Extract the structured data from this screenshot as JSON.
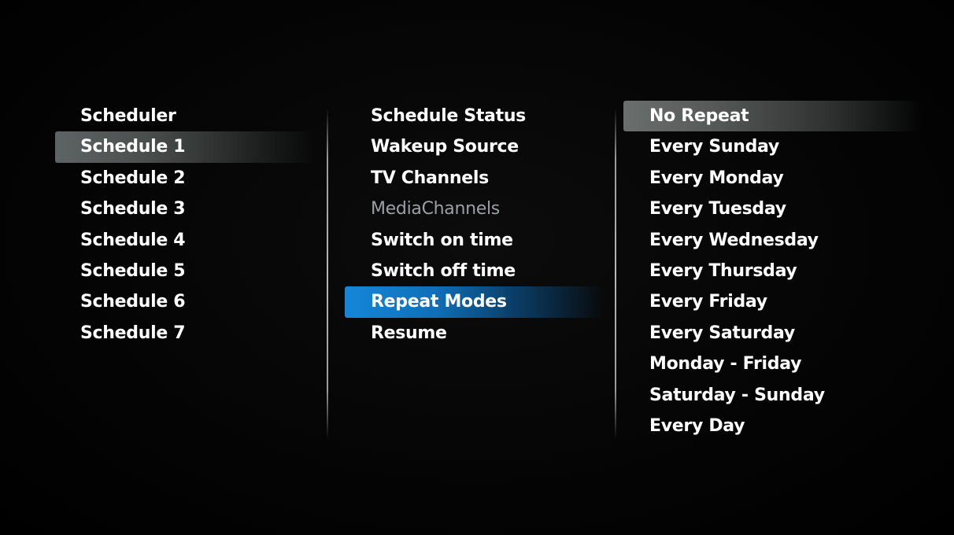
{
  "left_menu": {
    "header": "Scheduler",
    "items": [
      "Schedule 1",
      "Schedule 2",
      "Schedule 3",
      "Schedule 4",
      "Schedule 5",
      "Schedule 6",
      "Schedule 7"
    ],
    "selected": "Schedule 1"
  },
  "middle_menu": {
    "items": [
      "Schedule Status",
      "Wakeup Source",
      "TV Channels",
      "MediaChannels",
      "Switch on time",
      "Switch off time",
      "Repeat Modes",
      "Resume"
    ],
    "disabled": "MediaChannels",
    "selected": "Repeat Modes"
  },
  "right_menu": {
    "items": [
      "No Repeat",
      "Every Sunday",
      "Every Monday",
      "Every Tuesday",
      "Every Wednesday",
      "Every Thursday",
      "Every Friday",
      "Every Saturday",
      "Monday - Friday",
      "Saturday - Sunday",
      "Every Day"
    ],
    "selected": "No Repeat"
  },
  "colors": {
    "background": "#000000",
    "text": "#ffffff",
    "disabled_text": "#9aa0a6",
    "focus_gray": "#5e6463",
    "active_blue": "#1587d8"
  }
}
